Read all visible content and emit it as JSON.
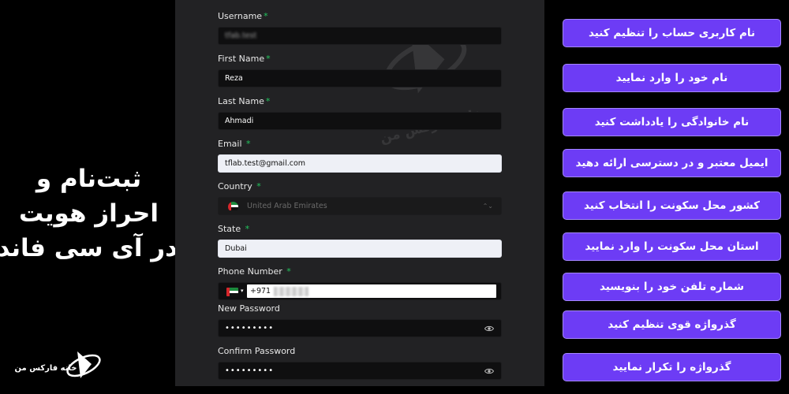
{
  "title": {
    "lines": [
      "ثبت‌نام و",
      "احراز هویت",
      "در آی سی فاندد"
    ]
  },
  "logo": {
    "text": "خانه فارکس من"
  },
  "watermark": {
    "text": "خانه فارکس من"
  },
  "form": {
    "username": {
      "label": "Username",
      "value": "tfab.test"
    },
    "first_name": {
      "label": "First Name",
      "value": "Reza"
    },
    "last_name": {
      "label": "Last Name",
      "value": "Ahmadi"
    },
    "email": {
      "label": "Email",
      "value": "tflab.test@gmail.com"
    },
    "country": {
      "label": "Country",
      "value": "United Arab Emirates"
    },
    "state": {
      "label": "State",
      "value": "Dubai"
    },
    "phone": {
      "label": "Phone Number",
      "code": "+971"
    },
    "new_password": {
      "label": "New Password",
      "value": "•••••••••"
    },
    "confirm_password": {
      "label": "Confirm Password",
      "value": "•••••••••"
    },
    "required_mark": "*"
  },
  "steps": [
    "نام کاربری حساب را تنظیم کنید",
    "نام خود را وارد نمایید",
    "نام خانوادگی را یادداشت کنید",
    "ایمیل معتبر و در دسترسی ارائه دهید",
    "کشور محل سکونت را انتخاب کنید",
    "استان محل سکونت را وارد نمایید",
    "شماره تلفن خود را بنویسید",
    "گذرواژه قوی تنظیم کنید",
    "گذرواژه را تکرار نمایید"
  ],
  "colors": {
    "step_bg": "#6d3cf5",
    "required": "#22c55e",
    "panel": "#222224"
  }
}
